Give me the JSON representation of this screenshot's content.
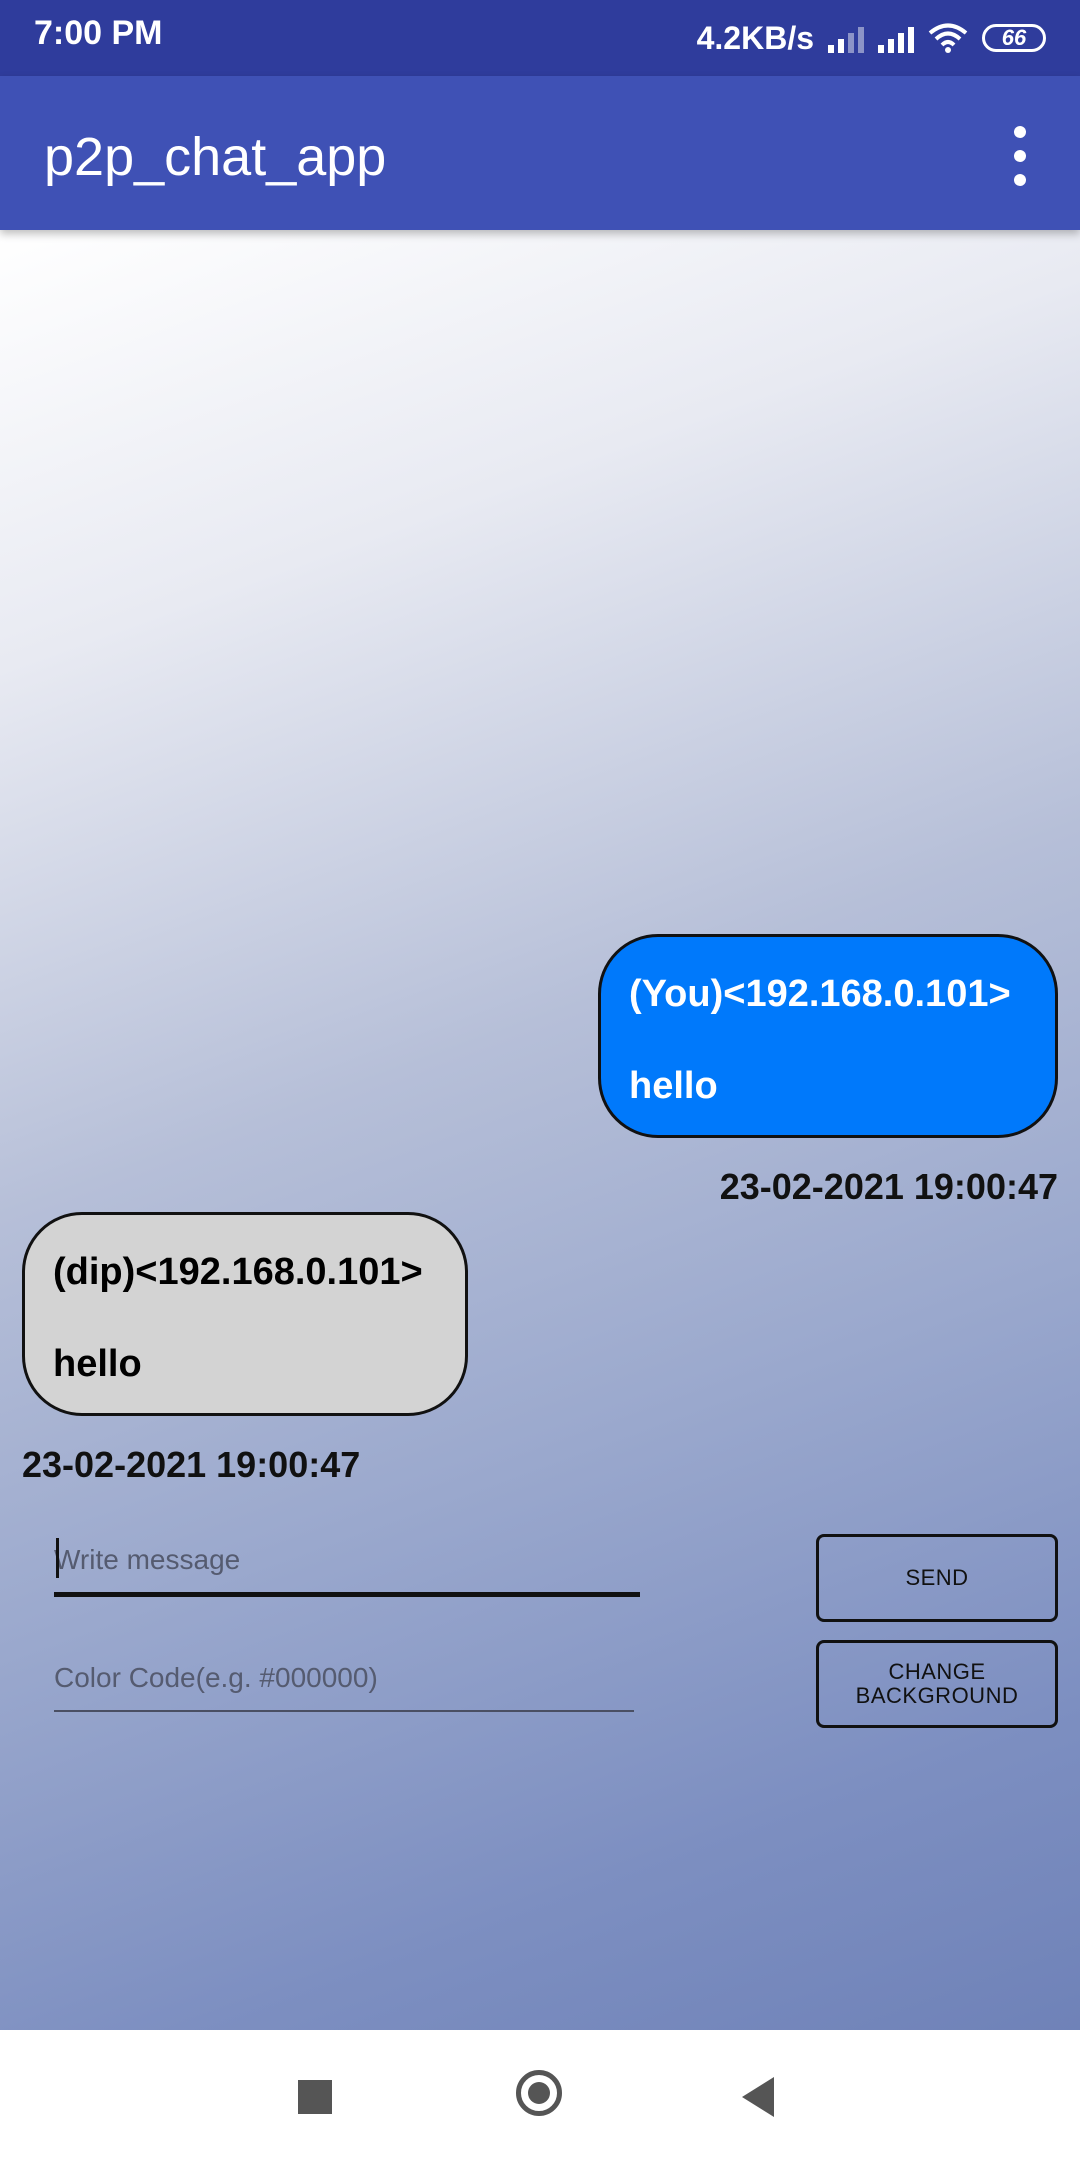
{
  "status_bar": {
    "time": "7:00 PM",
    "network_speed": "4.2KB/s",
    "battery_level": "66",
    "icons": [
      "signal-icon",
      "signal-icon",
      "wifi-icon",
      "battery-icon"
    ]
  },
  "app_bar": {
    "title": "p2p_chat_app",
    "menu_icon": "more-vert-icon"
  },
  "theme": {
    "app_bar_color": "#3f51b5",
    "status_bar_color": "#2f3c9c",
    "sent_bubble_color": "#0079fb",
    "received_bubble_color": "#d3d3d3"
  },
  "messages": [
    {
      "direction": "sent",
      "sender": "(You)<192.168.0.101>",
      "text": "hello",
      "timestamp": "23-02-2021 19:00:47"
    },
    {
      "direction": "received",
      "sender": "(dip)<192.168.0.101>",
      "text": "hello",
      "timestamp": "23-02-2021 19:00:47"
    }
  ],
  "composer": {
    "message_placeholder": "Write message",
    "message_value": "",
    "color_placeholder": "Color Code(e.g. #000000)",
    "color_value": "",
    "send_label": "SEND",
    "change_background_label": "CHANGE BACKGROUND"
  },
  "nav_bar": {
    "icons": [
      "recent-apps-icon",
      "home-icon",
      "back-icon"
    ]
  }
}
